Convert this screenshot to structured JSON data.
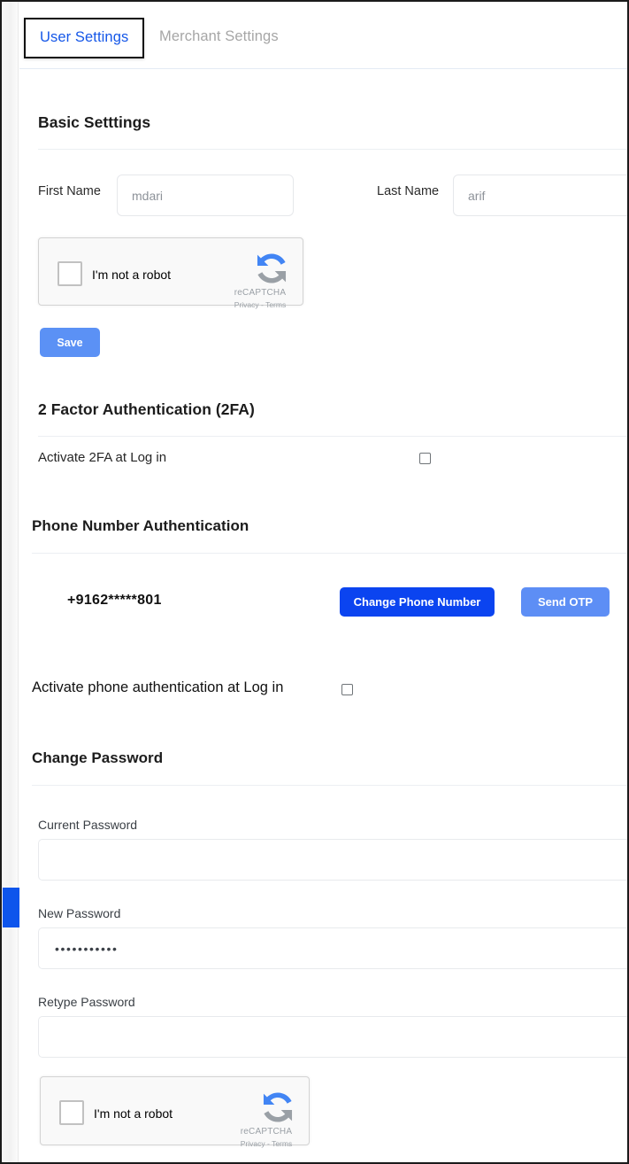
{
  "tabs": [
    {
      "label": "User Settings",
      "active": true
    },
    {
      "label": "Merchant Settings",
      "active": false
    }
  ],
  "basic_settings": {
    "title": "Basic Setttings",
    "first_name": {
      "label": "First Name",
      "value": "",
      "placeholder": "mdari"
    },
    "last_name": {
      "label": "Last Name",
      "value": "",
      "placeholder": "arif"
    },
    "save_label": "Save"
  },
  "recaptcha": {
    "checkbox_label": "I'm not a robot",
    "brand": "reCAPTCHA",
    "legal": "Privacy - Terms",
    "checked": false
  },
  "two_factor": {
    "title": "2 Factor Authentication (2FA)",
    "activate_label": "Activate 2FA at Log in",
    "activate_checked": false
  },
  "phone_auth": {
    "title": "Phone Number Authentication",
    "number": "+9162*****801",
    "change_label": "Change Phone Number",
    "otp_label": "Send OTP",
    "activate_label": "Activate phone authentication at Log in",
    "activate_checked": false
  },
  "change_password": {
    "title": "Change Password",
    "current": {
      "label": "Current Password",
      "value": ""
    },
    "new": {
      "label": "New Password",
      "value": "•••••••••••"
    },
    "retype": {
      "label": "Retype Password",
      "value": ""
    }
  },
  "colors": {
    "accent_blue": "#1557e8",
    "save_blue": "#5b91f5",
    "change_blue": "#0b44f0",
    "otp_blue": "#5d8ef5",
    "scroll_thumb": "#0d55ec",
    "inactive_tab": "#a6a6a6"
  }
}
